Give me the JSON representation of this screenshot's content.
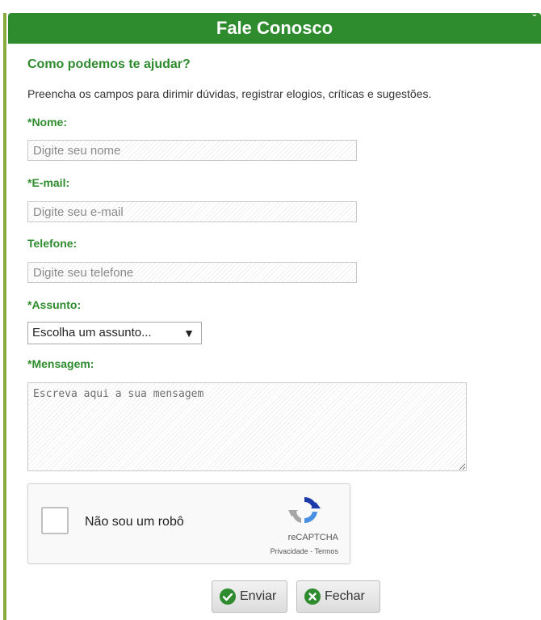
{
  "header": {
    "title": "Fale Conosco",
    "collapse_icon": "chevron-down-icon"
  },
  "intro": {
    "heading": "Como podemos te ajudar?",
    "description": "Preencha os campos para dirimir dúvidas, registrar elogios, críticas e sugestões."
  },
  "form": {
    "name": {
      "label": "*Nome:",
      "placeholder": "Digite seu nome",
      "value": ""
    },
    "email": {
      "label": "*E-mail:",
      "placeholder": "Digite seu e-mail",
      "value": ""
    },
    "phone": {
      "label": "Telefone:",
      "placeholder": "Digite seu telefone",
      "value": ""
    },
    "subject": {
      "label": "*Assunto:",
      "selected": "Escolha um assunto...",
      "arrow": "▼"
    },
    "message": {
      "label": "*Mensagem:",
      "placeholder": "Escreva aqui a sua mensagem",
      "value": ""
    }
  },
  "captcha": {
    "label": "Não sou um robô",
    "brand": "reCAPTCHA",
    "terms": "Privacidade - Termos"
  },
  "buttons": {
    "send_label": "Enviar",
    "close_label": "Fechar"
  },
  "colors": {
    "accent": "#2e8b2e",
    "send_icon": "#2e8b2e",
    "close_icon": "#2e8b2e"
  }
}
